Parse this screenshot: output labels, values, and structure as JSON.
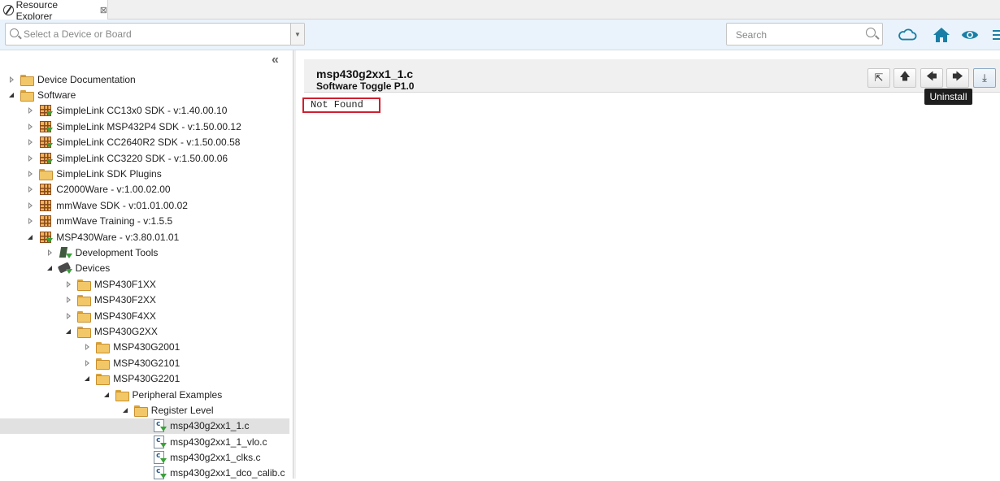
{
  "tab": {
    "title": "Resource Explorer",
    "close_glyph": "⊠"
  },
  "toolbar": {
    "device_placeholder": "Select a Device or Board",
    "dropdown_glyph": "▼",
    "search_placeholder": "Search",
    "icons": [
      "cloud-icon",
      "home-icon",
      "eye-icon",
      "menu-icon"
    ],
    "accent_color": "#1a7fa6"
  },
  "tree": {
    "collapse_glyph": "«",
    "items": [
      {
        "label": "Device Documentation",
        "level": 0,
        "state": "collapsed",
        "icon": "folder"
      },
      {
        "label": "Software",
        "level": 0,
        "state": "expanded",
        "icon": "folder"
      },
      {
        "label": "SimpleLink CC13x0 SDK - v:1.40.00.10",
        "level": 1,
        "state": "collapsed",
        "icon": "package-download"
      },
      {
        "label": "SimpleLink MSP432P4 SDK - v:1.50.00.12",
        "level": 1,
        "state": "collapsed",
        "icon": "package-download"
      },
      {
        "label": "SimpleLink CC2640R2 SDK - v:1.50.00.58",
        "level": 1,
        "state": "collapsed",
        "icon": "package-download"
      },
      {
        "label": "SimpleLink CC3220 SDK - v:1.50.00.06",
        "level": 1,
        "state": "collapsed",
        "icon": "package-download"
      },
      {
        "label": "SimpleLink SDK Plugins",
        "level": 1,
        "state": "collapsed",
        "icon": "folder"
      },
      {
        "label": "C2000Ware - v:1.00.02.00",
        "level": 1,
        "state": "collapsed",
        "icon": "package"
      },
      {
        "label": "mmWave SDK - v:01.01.00.02",
        "level": 1,
        "state": "collapsed",
        "icon": "package"
      },
      {
        "label": "mmWave Training - v:1.5.5",
        "level": 1,
        "state": "collapsed",
        "icon": "package"
      },
      {
        "label": "MSP430Ware - v:3.80.01.01",
        "level": 1,
        "state": "expanded",
        "icon": "package-download"
      },
      {
        "label": "Development Tools",
        "level": 2,
        "state": "collapsed",
        "icon": "tools"
      },
      {
        "label": "Devices",
        "level": 2,
        "state": "expanded",
        "icon": "chip"
      },
      {
        "label": "MSP430F1XX",
        "level": 3,
        "state": "collapsed",
        "icon": "folder"
      },
      {
        "label": "MSP430F2XX",
        "level": 3,
        "state": "collapsed",
        "icon": "folder"
      },
      {
        "label": "MSP430F4XX",
        "level": 3,
        "state": "collapsed",
        "icon": "folder"
      },
      {
        "label": "MSP430G2XX",
        "level": 3,
        "state": "expanded",
        "icon": "folder"
      },
      {
        "label": "MSP430G2001",
        "level": 4,
        "state": "collapsed",
        "icon": "folder"
      },
      {
        "label": "MSP430G2101",
        "level": 4,
        "state": "collapsed",
        "icon": "folder"
      },
      {
        "label": "MSP430G2201",
        "level": 4,
        "state": "expanded",
        "icon": "folder"
      },
      {
        "label": "Peripheral Examples",
        "level": 5,
        "state": "expanded",
        "icon": "folder"
      },
      {
        "label": "Register Level",
        "level": 6,
        "state": "expanded",
        "icon": "folder"
      },
      {
        "label": "msp430g2xx1_1.c",
        "level": 7,
        "state": "none",
        "icon": "file",
        "selected": true
      },
      {
        "label": "msp430g2xx1_1_vlo.c",
        "level": 7,
        "state": "none",
        "icon": "file"
      },
      {
        "label": "msp430g2xx1_clks.c",
        "level": 7,
        "state": "none",
        "icon": "file"
      },
      {
        "label": "msp430g2xx1_dco_calib.c",
        "level": 7,
        "state": "none",
        "icon": "file"
      }
    ]
  },
  "content": {
    "title": "msp430g2xx1_1.c",
    "subtitle": "Software Toggle P1.0",
    "buttons": [
      {
        "name": "open-external-button",
        "glyph": "⇱"
      },
      {
        "name": "up-button",
        "glyph": "🡅"
      },
      {
        "name": "back-button",
        "glyph": "🡄"
      },
      {
        "name": "forward-button",
        "glyph": "🡆"
      },
      {
        "name": "uninstall-button",
        "glyph": "⤓"
      }
    ],
    "tooltip": "Uninstall",
    "body_text": "Not Found"
  }
}
